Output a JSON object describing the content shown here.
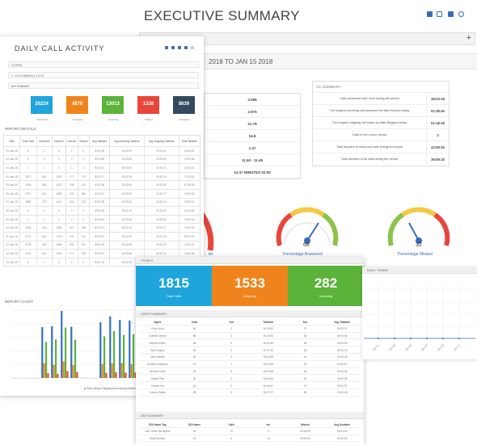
{
  "exec": {
    "title": "EXECUTIVE SUMMARY",
    "bar_label": "FILTERS",
    "plus": "+",
    "date_range": "2018 TO JAN 15 2018",
    "left_values": [
      "3.086",
      "2.975",
      "21.79",
      "15.8",
      "1.47",
      "11.50 - 11.49",
      "14:47 MINUTES 02:00"
    ],
    "cc_title": "CC SUMMARY",
    "cc_rows": [
      {
        "d": "Calls answered each hour during the period",
        "v": "36:03:18"
      },
      {
        "d": "The longest incoming call answered by Mike Bowers today",
        "v": "01:38:45"
      },
      {
        "d": "The longest outgoing call made by Mike Buggers today",
        "v": "01:18:18"
      },
      {
        "d": "Calls in the 4-hour period",
        "v": "2"
      },
      {
        "d": "Total duration of outbound calls during the period",
        "v": "42:59:19"
      },
      {
        "d": "Total duration of all calls during the period",
        "v": "36:08:18"
      }
    ],
    "gauges": [
      {
        "label": "Percentage Answered",
        "value": "68"
      },
      {
        "label": "Percentage Missed",
        "value": "32"
      }
    ]
  },
  "daily": {
    "title": "DAILY CALL ACTIVITY",
    "filters": [
      "FILTERS",
      "1 - 2 of 10 (filtered) 1 2 3 4 5",
      "DAY SUMMARY"
    ],
    "kpis": [
      {
        "value": "26224",
        "label": "Total Calls",
        "color": "#1fa5dc"
      },
      {
        "value": "4876",
        "label": "Outgoing",
        "color": "#f0841c"
      },
      {
        "value": "13013",
        "label": "Incoming",
        "color": "#5bb33a"
      },
      {
        "value": "1338",
        "label": "Missed",
        "color": "#e8463a"
      },
      {
        "value": "8639",
        "label": "Answered",
        "color": "#34495e"
      }
    ],
    "details_label": "REPORT DETAILS",
    "chart_label": "REPORT CHART",
    "table_headers": [
      "Date",
      "Total Calls",
      "Outbound",
      "Inbound",
      "Internal",
      "Missed",
      "Avg Talktime",
      "Avg Incoming Talktime",
      "Avg Outgoing Talktime",
      "Total Talktime"
    ],
    "table_rows": [
      [
        "01-Jan-18",
        "8",
        "2",
        "6",
        "0",
        "0",
        "00:02:06",
        "00:02:04",
        "00:02:11",
        "00:16:51"
      ],
      [
        "02-Jan-18",
        "3",
        "0",
        "3",
        "0",
        "1",
        "00:00:59",
        "00:00:59",
        "00:00:00",
        "00:02:58"
      ],
      [
        "03-Jan-18",
        "1",
        "1",
        "0",
        "0",
        "0",
        "00:00:21",
        "00:00:00",
        "00:00:21",
        "00:00:21"
      ],
      [
        "04-Jan-18",
        "1872",
        "542",
        "1330",
        "172",
        "176",
        "00:02:17",
        "00:02:16",
        "00:02:19",
        "71:23:41"
      ],
      [
        "05-Jan-18",
        "1906",
        "484",
        "1422",
        "168",
        "151",
        "00:02:08",
        "00:02:09",
        "00:02:06",
        "67:55:34"
      ],
      [
        "06-Jan-18",
        "2470",
        "612",
        "1858",
        "190",
        "254",
        "00:02:11",
        "00:02:09",
        "00:02:17",
        "90:05:49"
      ],
      [
        "07-Jan-18",
        "1888",
        "474",
        "1414",
        "160",
        "213",
        "00:02:05",
        "00:02:03",
        "00:02:10",
        "65:30:22"
      ],
      [
        "08-Jan-18",
        "8",
        "2",
        "6",
        "0",
        "2",
        "00:01:50",
        "00:01:49",
        "00:01:52",
        "00:14:40"
      ],
      [
        "09-Jan-18",
        "1",
        "0",
        "1",
        "0",
        "0",
        "00:00:44",
        "00:00:44",
        "00:00:00",
        "00:00:44"
      ],
      [
        "10-Jan-18",
        "2049",
        "513",
        "1536",
        "187",
        "186",
        "00:02:14",
        "00:02:13",
        "00:02:17",
        "76:19:26"
      ],
      [
        "11-Jan-18",
        "2270",
        "541",
        "1729",
        "176",
        "210",
        "00:02:10",
        "00:02:10",
        "00:02:10",
        "82:01:40"
      ],
      [
        "12-Jan-18",
        "2139",
        "550",
        "1589",
        "182",
        "197",
        "00:02:09",
        "00:02:08",
        "00:02:12",
        "76:41:51"
      ],
      [
        "13-Jan-18",
        "2118",
        "504",
        "1614",
        "171",
        "204",
        "00:02:07",
        "00:02:06",
        "00:02:10",
        "74:42:06"
      ],
      [
        "14-Jan-18",
        "6",
        "1",
        "5",
        "0",
        "0",
        "00:01:31",
        "00:01:30",
        "00:01:35",
        "00:09:06"
      ]
    ],
    "chart_legend": "■ Total Calls ■ Outgoing ■ Incoming ■ Missed"
  },
  "chart_data": {
    "type": "bar",
    "categories": [
      "01",
      "02",
      "03",
      "04",
      "05",
      "06",
      "07",
      "08",
      "09",
      "10",
      "11",
      "12",
      "13"
    ],
    "series": [
      {
        "values": [
          8,
          3,
          1,
          1872,
          1906,
          2470,
          1888,
          8,
          1,
          2049,
          2270,
          2139,
          2118
        ],
        "color": "#2f6fbf"
      },
      {
        "values": [
          2,
          0,
          1,
          542,
          484,
          612,
          474,
          2,
          0,
          513,
          541,
          550,
          504
        ],
        "color": "#f0841c"
      },
      {
        "values": [
          6,
          3,
          0,
          1330,
          1422,
          1858,
          1414,
          6,
          1,
          1536,
          1729,
          1589,
          1614
        ],
        "color": "#5bb33a"
      },
      {
        "values": [
          0,
          1,
          0,
          176,
          151,
          254,
          213,
          2,
          0,
          186,
          210,
          197,
          204
        ],
        "color": "#e8463a"
      }
    ],
    "ylim": [
      0,
      2500
    ]
  },
  "totals": {
    "bar_label": "TOTALS",
    "tiles": [
      {
        "value": "1815",
        "label": "Total Calls",
        "color": "#1fa5dc"
      },
      {
        "value": "1533",
        "label": "Outgoing",
        "color": "#f0841c"
      },
      {
        "value": "282",
        "label": "Incoming",
        "color": "#5bb33a"
      }
    ],
    "agent_label": "USER SUMMARY",
    "agent_headers": [
      "Agent",
      "Calls",
      "Out",
      "Talktime",
      "Dur",
      "Avg Talktime"
    ],
    "agents": [
      [
        "Chris Scott",
        "36",
        "2",
        "00:20:55",
        "37",
        "00:00:07"
      ],
      [
        "Collette Greene",
        "58",
        "3",
        "00:20:50",
        "38",
        "00:00:06"
      ],
      [
        "Stephen Rider",
        "48",
        "3",
        "00:03:40",
        "36",
        "00:00:05"
      ],
      [
        "Sam Rogers",
        "46",
        "4",
        "00:07:32",
        "35",
        "00:00:03"
      ],
      [
        "Jack Nimble",
        "40",
        "3",
        "00:03:49",
        "44",
        "00:00:06"
      ],
      [
        "Andrew Chapman",
        "47",
        "1",
        "00:20:49",
        "48",
        "00:00:07"
      ],
      [
        "Brenda Grant",
        "45",
        "4",
        "00:03:38",
        "46",
        "00:00:05"
      ],
      [
        "James Pirie",
        "40",
        "2",
        "00:03:44",
        "43",
        "00:00:08"
      ],
      [
        "Carmel Fox",
        "42",
        "2",
        "00:20:47",
        "47",
        "00:00:07"
      ],
      [
        "Connor Walsh",
        "38",
        "3",
        "00:07:37",
        "49",
        "00:00:06"
      ]
    ],
    "ddi_label": "DDI SUMMARY",
    "ddi_headers": [
      "DDI Name Tag",
      "DDI Name",
      "Calls",
      "Inc",
      "Missed",
      "Avg Duration"
    ],
    "ddis": [
      [
        "Call Centre Reception",
        "50",
        "70",
        "0",
        "00:00:00",
        "00:01:00"
      ],
      [
        "Main Number",
        "44",
        "6",
        "10",
        "00:00:00",
        "00:00:00"
      ]
    ]
  },
  "linechart": {
    "label": "DAILY TREND"
  }
}
